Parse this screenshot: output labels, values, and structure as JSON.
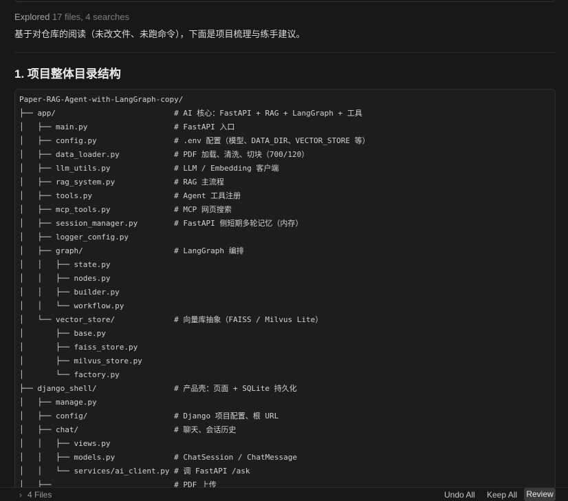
{
  "explored": {
    "label": "Explored",
    "detail": "17 files, 4 searches"
  },
  "intro": "基于对仓库的阅读（未改文件、未跑命令），下面是项目梳理与练手建议。",
  "section_heading": "1. 项目整体目录结构",
  "code_block": {
    "lines": [
      {
        "path": "Paper-RAG-Agent-with-LangGraph-copy/"
      },
      {
        "path": "├── app/",
        "comment": "# AI 核心：FastAPI + RAG + LangGraph + 工具"
      },
      {
        "path": "│   ├── main.py",
        "comment": "# FastAPI 入口"
      },
      {
        "path": "│   ├── config.py",
        "comment": "# .env 配置（模型、DATA_DIR、VECTOR_STORE 等）"
      },
      {
        "path": "│   ├── data_loader.py",
        "comment": "# PDF 加载、清洗、切块（700/120）"
      },
      {
        "path": "│   ├── llm_utils.py",
        "comment": "# LLM / Embedding 客户端"
      },
      {
        "path": "│   ├── rag_system.py",
        "comment": "# RAG 主流程"
      },
      {
        "path": "│   ├── tools.py",
        "comment": "# Agent 工具注册"
      },
      {
        "path": "│   ├── mcp_tools.py",
        "comment": "# MCP 网页搜索"
      },
      {
        "path": "│   ├── session_manager.py",
        "comment": "# FastAPI 侧短期多轮记忆（内存）"
      },
      {
        "path": "│   ├── logger_config.py"
      },
      {
        "path": "│   ├── graph/",
        "comment": "# LangGraph 编排"
      },
      {
        "path": "│   │   ├── state.py"
      },
      {
        "path": "│   │   ├── nodes.py"
      },
      {
        "path": "│   │   ├── builder.py"
      },
      {
        "path": "│   │   └── workflow.py"
      },
      {
        "path": "│   └── vector_store/",
        "comment": "# 向量库抽象（FAISS / Milvus Lite）"
      },
      {
        "path": "│       ├── base.py"
      },
      {
        "path": "│       ├── faiss_store.py"
      },
      {
        "path": "│       ├── milvus_store.py"
      },
      {
        "path": "│       └── factory.py"
      },
      {
        "path": "├── django_shell/",
        "comment": "# 产品壳：页面 + SQLite 持久化"
      },
      {
        "path": "│   ├── manage.py"
      },
      {
        "path": "│   ├── config/",
        "comment": "# Django 项目配置、根 URL"
      },
      {
        "path": "│   ├── chat/",
        "comment": "# 聊天、会话历史"
      },
      {
        "path": "│   │   ├── views.py"
      },
      {
        "path": "│   │   ├── models.py",
        "comment": "# ChatSession / ChatMessage"
      },
      {
        "path": "│   │   └── services/ai_client.py",
        "comment": "# 调 FastAPI /ask"
      },
      {
        "path": "│   ├──",
        "comment": "# PDF 上传"
      }
    ]
  },
  "bottom_bar": {
    "files_icon": "chevron-right-icon",
    "files_toggle": "4 Files",
    "undo_all": "Undo All",
    "keep_all": "Keep All",
    "review": "Review"
  }
}
